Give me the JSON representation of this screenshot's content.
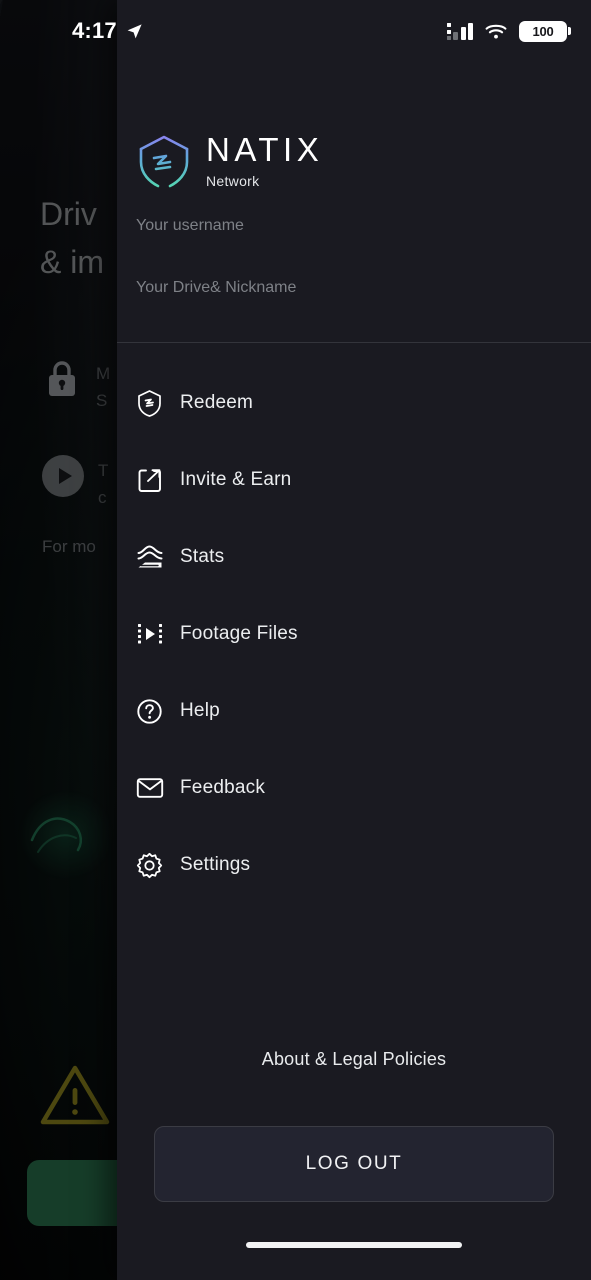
{
  "status_bar": {
    "time": "4:17",
    "location_icon": "location-arrow-icon",
    "signal_icon": "cellular-signal-icon",
    "wifi_icon": "wifi-icon",
    "battery_level": "100"
  },
  "background": {
    "heading_line1": "Driv",
    "heading_line2": "& im",
    "features": [
      {
        "icon": "lock-icon",
        "line1": "M",
        "line2": "S"
      },
      {
        "icon": "play-circle-icon",
        "line1": "T",
        "line2": "c"
      }
    ],
    "more_text": "For mo",
    "warning_icon": "warning-triangle-icon",
    "green_button": ""
  },
  "drawer": {
    "brand": {
      "logo_icon": "natix-shield-logo",
      "wordmark": "NATIX",
      "subword": "Network"
    },
    "user": {
      "username": "Your username",
      "nickname": "Your Drive& Nickname"
    },
    "menu": [
      {
        "label": "Redeem",
        "icon": "shield-badge-icon"
      },
      {
        "label": "Invite & Earn",
        "icon": "share-box-icon"
      },
      {
        "label": "Stats",
        "icon": "area-chart-icon"
      },
      {
        "label": "Footage Files",
        "icon": "film-play-icon"
      },
      {
        "label": "Help",
        "icon": "question-circle-icon"
      },
      {
        "label": "Feedback",
        "icon": "envelope-icon"
      },
      {
        "label": "Settings",
        "icon": "gear-icon"
      }
    ],
    "footer": {
      "about_link": "About & Legal Policies",
      "logout_label": "LOG OUT"
    }
  },
  "colors": {
    "drawer_bg": "#1a1a21",
    "page_bg": "#050506",
    "divider": "#33343b",
    "label": "#eceef0",
    "muted": "#7e8187",
    "logo_top": "#7b7ce8",
    "logo_bottom": "#56d4b4",
    "green_button": "#2c7a52",
    "warning": "#9a9121"
  }
}
